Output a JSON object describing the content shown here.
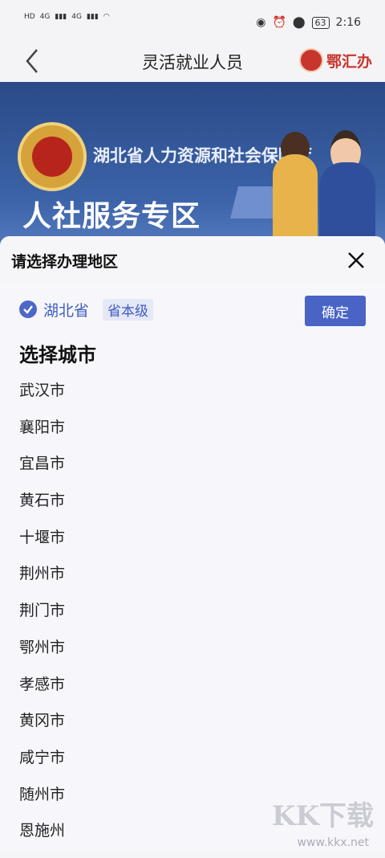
{
  "status_bar": {
    "time": "2:16",
    "battery": "63",
    "network_a": "4G",
    "network_b": "4G",
    "hd": "HD"
  },
  "nav": {
    "title": "灵活就业人员",
    "logo_text": "鄂汇办"
  },
  "banner": {
    "org": "湖北省人力资源和社会保障厅",
    "headline": "人社服务专区"
  },
  "sheet": {
    "title": "请选择办理地区",
    "province": "湖北省",
    "province_tag": "省本级",
    "confirm_label": "确定",
    "section_title": "选择城市",
    "cities": [
      "武汉市",
      "襄阳市",
      "宜昌市",
      "黄石市",
      "十堰市",
      "荆州市",
      "荆门市",
      "鄂州市",
      "孝感市",
      "黄冈市",
      "咸宁市",
      "随州市",
      "恩施州"
    ]
  },
  "watermark": {
    "main": "KK下载",
    "sub": "www.kkx.net"
  },
  "colors": {
    "accent": "#4a64c6",
    "brand_red": "#c8352c",
    "banner": "#2a4a88"
  }
}
